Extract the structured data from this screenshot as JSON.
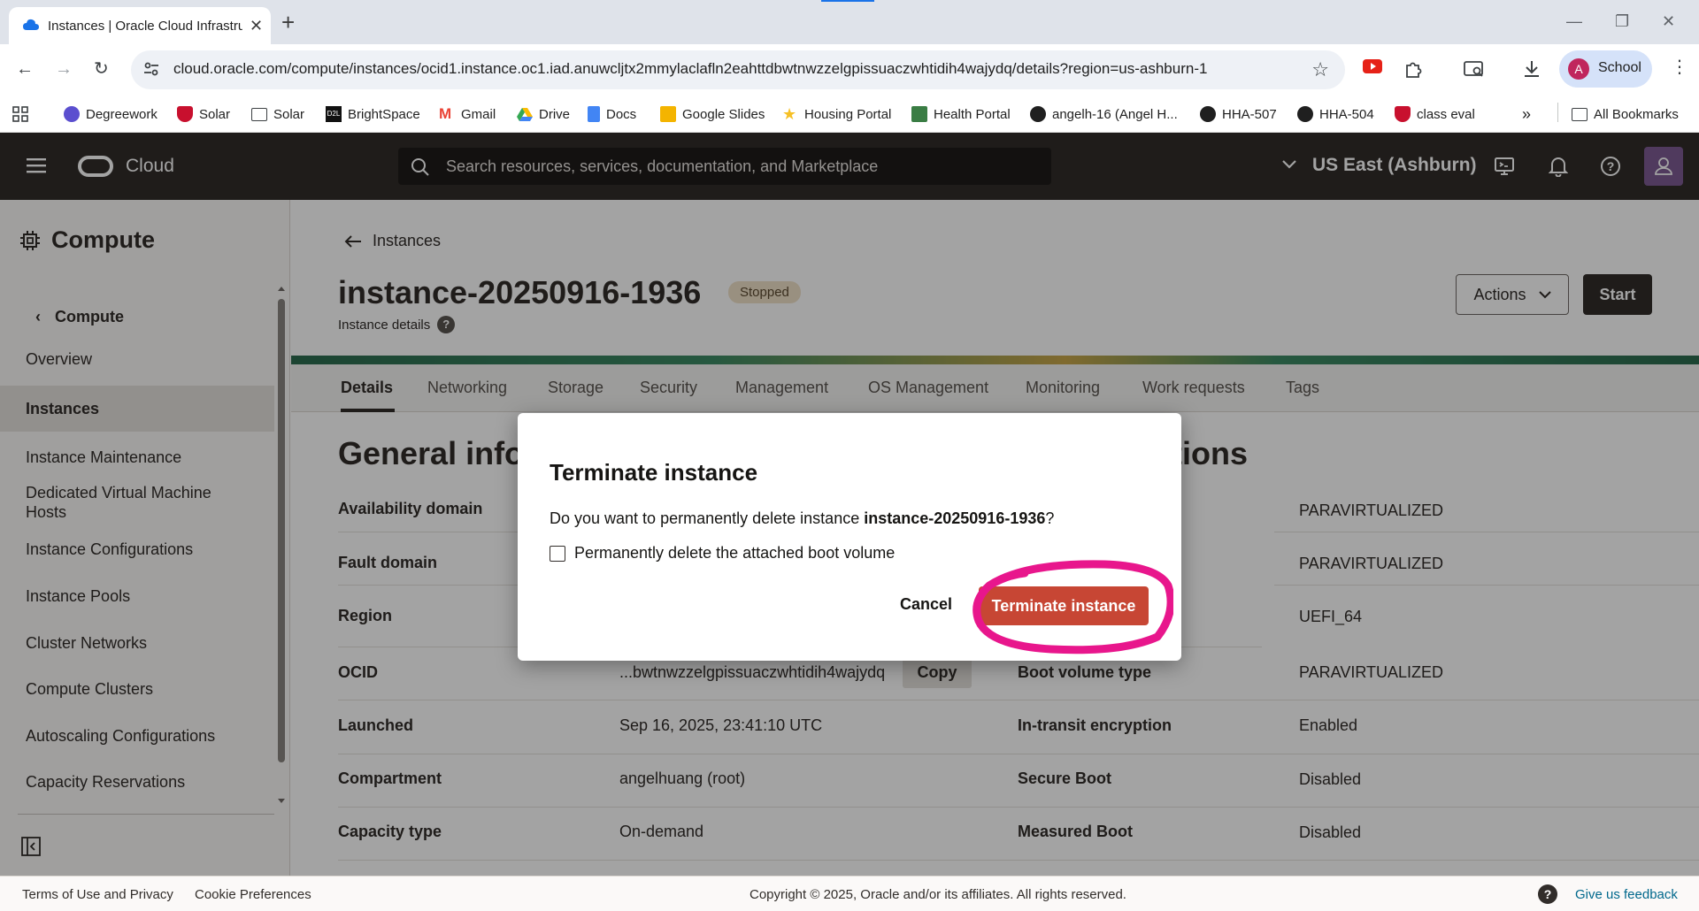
{
  "browser": {
    "tab_title": "Instances | Oracle Cloud Infrastructure",
    "url": "cloud.oracle.com/compute/instances/ocid1.instance.oc1.iad.anuwcljtx2mmylaclafln2eahttdbwtnwzzelgpissuaczwhtidih4wajydq/details?region=us-ashburn-1",
    "profile_initial": "A",
    "profile_label": "School",
    "bookmarks": [
      {
        "label": "Degreework",
        "icon": "degreeworks-icon"
      },
      {
        "label": "Solar",
        "icon": "shield-icon"
      },
      {
        "label": "Solar",
        "icon": "folder-icon"
      },
      {
        "label": "BrightSpace",
        "icon": "d2l-icon"
      },
      {
        "label": "Gmail",
        "icon": "gmail-icon"
      },
      {
        "label": "Drive",
        "icon": "drive-icon"
      },
      {
        "label": "Docs",
        "icon": "docs-icon"
      },
      {
        "label": "Google Slides",
        "icon": "slides-icon"
      },
      {
        "label": "Housing Portal",
        "icon": "star-icon"
      },
      {
        "label": "Health Portal",
        "icon": "health-icon"
      },
      {
        "label": "angelh-16 (Angel H...",
        "icon": "github-icon"
      },
      {
        "label": "HHA-507",
        "icon": "github-icon"
      },
      {
        "label": "HHA-504",
        "icon": "github-icon"
      },
      {
        "label": "class eval",
        "icon": "shield-icon"
      }
    ],
    "all_bookmarks": "All Bookmarks",
    "more_bookmarks": "»"
  },
  "header": {
    "brand": "Cloud",
    "search_placeholder": "Search resources, services, documentation, and Marketplace",
    "region": "US East (Ashburn)"
  },
  "sidebar": {
    "title": "Compute",
    "back_label": "Compute",
    "items": [
      {
        "label": "Overview",
        "active": false
      },
      {
        "label": "Instances",
        "active": true
      },
      {
        "label": "Instance Maintenance",
        "active": false
      },
      {
        "label": "Dedicated Virtual Machine Hosts",
        "active": false
      },
      {
        "label": "Instance Configurations",
        "active": false
      },
      {
        "label": "Instance Pools",
        "active": false
      },
      {
        "label": "Cluster Networks",
        "active": false
      },
      {
        "label": "Compute Clusters",
        "active": false
      },
      {
        "label": "Autoscaling Configurations",
        "active": false
      },
      {
        "label": "Capacity Reservations",
        "active": false
      }
    ]
  },
  "page": {
    "back_label": "Instances",
    "title": "instance-20250916-1936",
    "status": "Stopped",
    "subtitle": "Instance details",
    "actions_label": "Actions",
    "start_label": "Start",
    "tabs": [
      "Details",
      "Networking",
      "Storage",
      "Security",
      "Management",
      "OS Management",
      "Monitoring",
      "Work requests",
      "Tags"
    ],
    "active_tab": "Details",
    "left_section_title": "General info",
    "right_section_title": "tions",
    "left_rows": [
      {
        "key": "Availability domain",
        "value": ""
      },
      {
        "key": "Fault domain",
        "value": ""
      },
      {
        "key": "Region",
        "value": ""
      },
      {
        "key": "OCID",
        "value": "...bwtnwzzelgpissuaczwhtidih4wajydq"
      },
      {
        "key": "Launched",
        "value": "Sep 16, 2025, 23:41:10 UTC"
      },
      {
        "key": "Compartment",
        "value": "angelhuang (root)"
      },
      {
        "key": "Capacity type",
        "value": "On-demand"
      }
    ],
    "copy_label": "Copy",
    "right_rows": [
      {
        "key": "",
        "value": "PARAVIRTUALIZED"
      },
      {
        "key": "",
        "value": "PARAVIRTUALIZED"
      },
      {
        "key": "",
        "value": "UEFI_64"
      },
      {
        "key": "Boot volume type",
        "value": "PARAVIRTUALIZED"
      },
      {
        "key": "In-transit encryption",
        "value": "Enabled"
      },
      {
        "key": "Secure Boot",
        "value": "Disabled"
      },
      {
        "key": "Measured Boot",
        "value": "Disabled"
      }
    ]
  },
  "modal": {
    "title": "Terminate instance",
    "message_prefix": "Do you want to permanently delete instance ",
    "message_instance": "instance-20250916-1936",
    "message_suffix": "?",
    "checkbox_label": "Permanently delete the attached boot volume",
    "checkbox_checked": false,
    "cancel_label": "Cancel",
    "confirm_label": "Terminate instance",
    "annotation_color": "#e8168c"
  },
  "footer": {
    "terms": "Terms of Use and Privacy",
    "cookies": "Cookie Preferences",
    "copyright": "Copyright © 2025, Oracle and/or its affiliates. All rights reserved.",
    "feedback": "Give us feedback"
  },
  "colors": {
    "oci_header": "#312d2a",
    "danger": "#c74634",
    "status_badge": "#f0e1c8",
    "annotation": "#e8168c"
  }
}
